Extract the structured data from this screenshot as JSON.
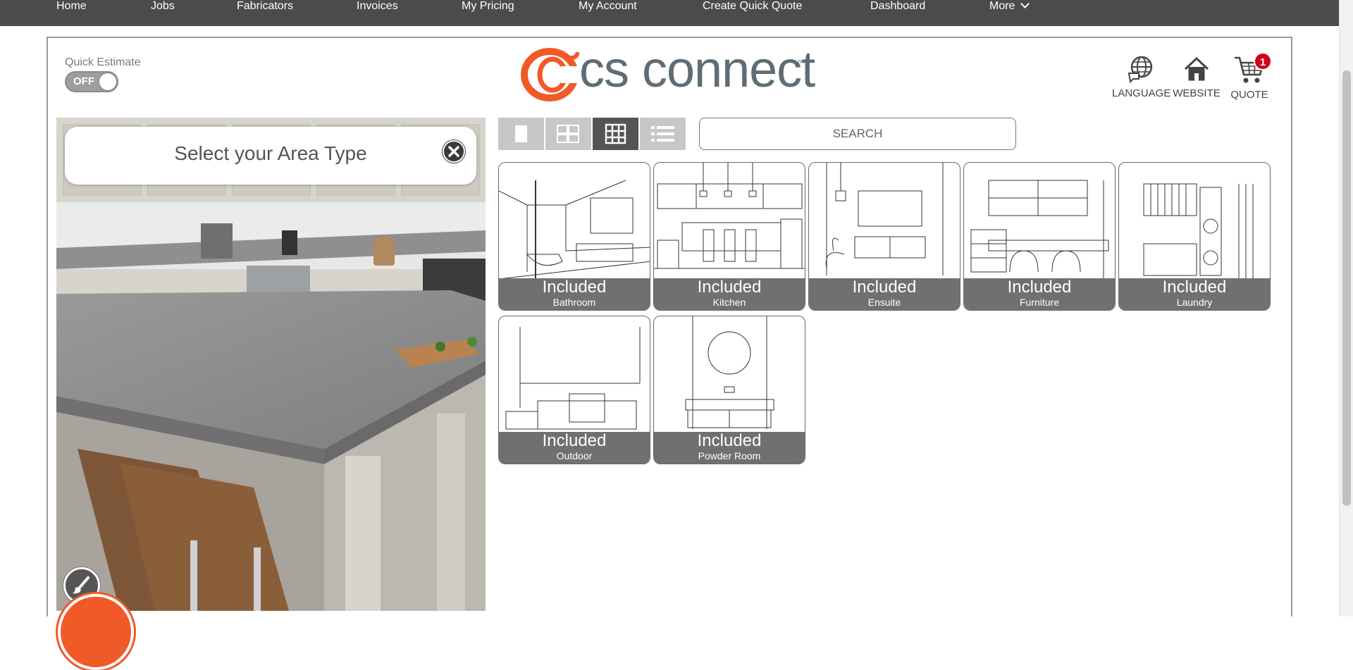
{
  "nav": {
    "items": [
      "Home",
      "Jobs",
      "Fabricators",
      "Invoices",
      "My Pricing",
      "My Account",
      "Create Quick Quote",
      "Dashboard",
      "More"
    ]
  },
  "quick_estimate": {
    "label": "Quick Estimate",
    "state": "OFF"
  },
  "logo": {
    "text": "cs connect",
    "tm": "™"
  },
  "header_icons": {
    "language": "LANGUAGE",
    "website": "WEBSITE",
    "quote": "QUOTE",
    "cart_count": "1"
  },
  "area_popup": {
    "title": "Select your Area Type"
  },
  "search": {
    "placeholder": "SEARCH"
  },
  "view_modes": [
    "single",
    "grid-2",
    "grid-3",
    "list"
  ],
  "active_view": "grid-3",
  "tiles": [
    {
      "status": "Included",
      "name": "Bathroom"
    },
    {
      "status": "Included",
      "name": "Kitchen"
    },
    {
      "status": "Included",
      "name": "Ensuite"
    },
    {
      "status": "Included",
      "name": "Furniture"
    },
    {
      "status": "Included",
      "name": "Laundry"
    },
    {
      "status": "Included",
      "name": "Outdoor"
    },
    {
      "status": "Included",
      "name": "Powder Room"
    }
  ],
  "colors": {
    "nav_bg": "#4b4b4b",
    "accent_orange": "#f05a28",
    "logo_gray": "#5e6d73",
    "badge_red": "#d0021b",
    "tile_bar": "#707070"
  }
}
